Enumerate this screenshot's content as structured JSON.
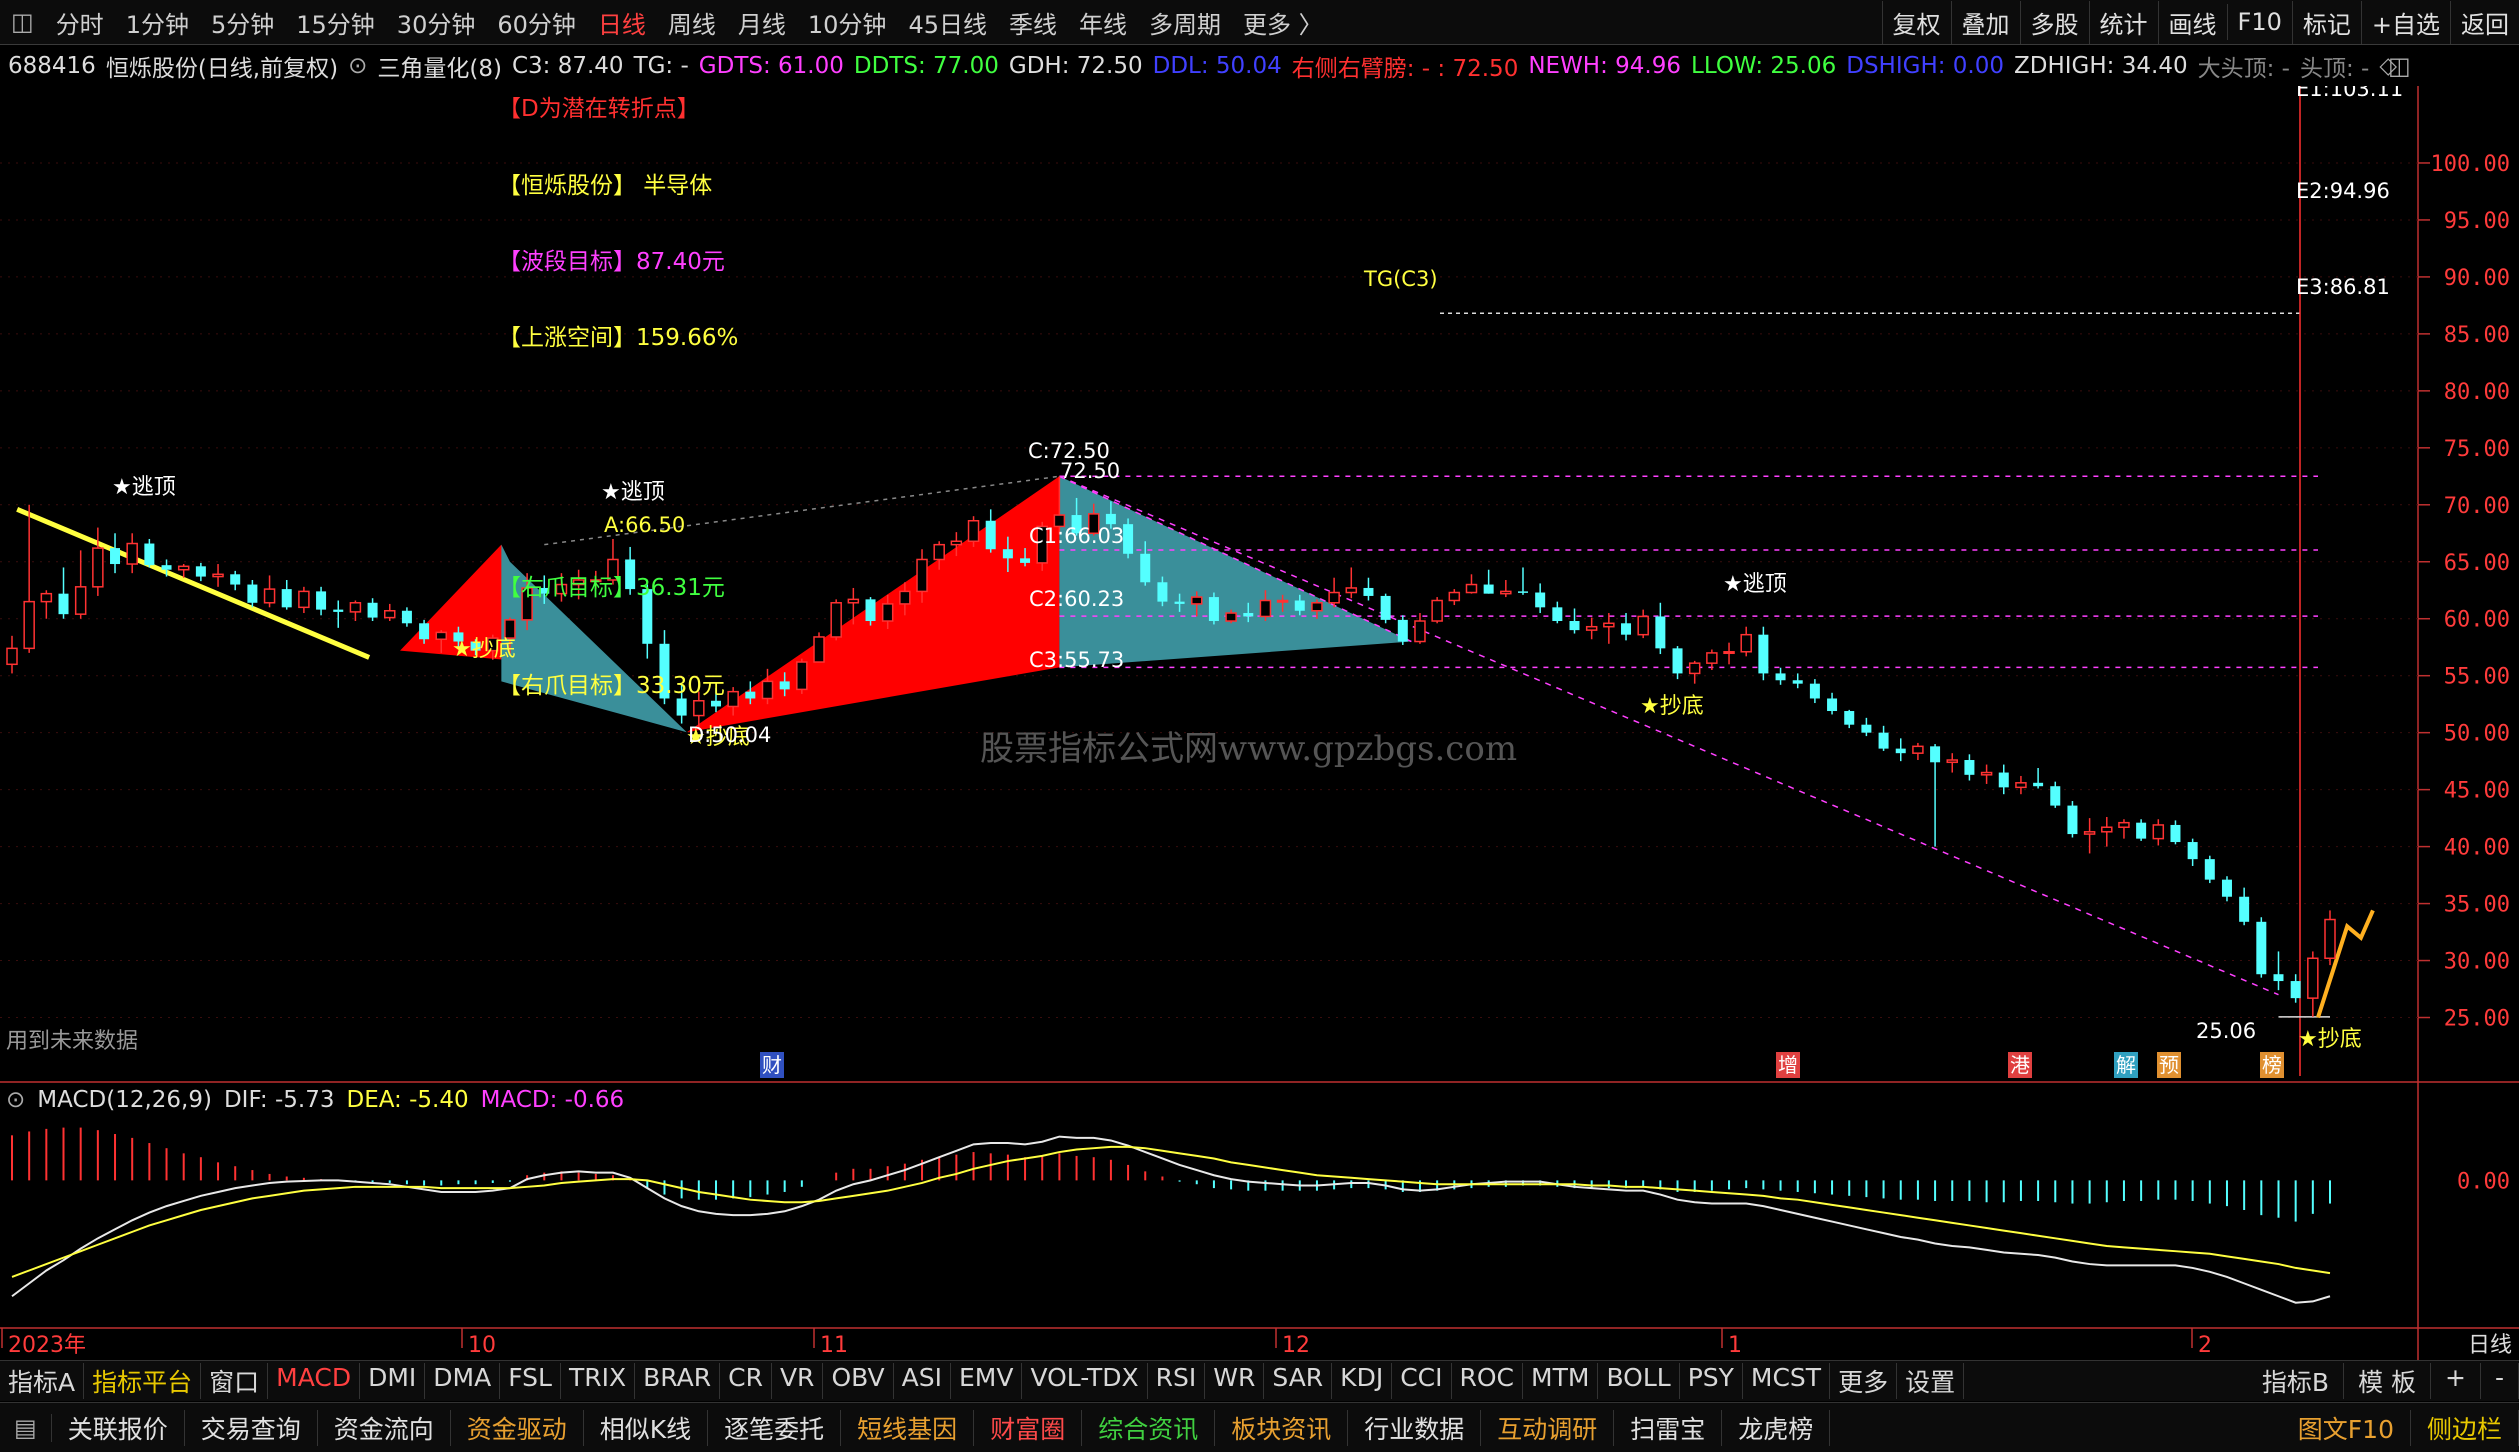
{
  "topbar": {
    "periods": [
      "分时",
      "1分钟",
      "5分钟",
      "15分钟",
      "30分钟",
      "60分钟",
      "日线",
      "周线",
      "月线",
      "10分钟",
      "45日线",
      "季线",
      "年线",
      "多周期",
      "更多 〉"
    ],
    "active_period": "日线",
    "right_buttons": [
      "复权",
      "叠加",
      "多股",
      "统计",
      "画线",
      "F10",
      "标记",
      "+自选",
      "返回"
    ]
  },
  "info": {
    "code": "688416",
    "name": "恒烁股份(日线,前复权)",
    "indicator": "三角量化(8)",
    "c3": "C3: 87.40",
    "tg": "TG: -",
    "gdts": "GDTS: 61.00",
    "ddts": "DDTS: 77.00",
    "gdh": "GDH: 72.50",
    "ddl": "DDL: 50.04",
    "right_arm": "右侧右臂膀: - : 72.50",
    "newh": "NEWH: 94.96",
    "llow": "LLOW: 25.06",
    "dshigh": "DSHIGH: 0.00",
    "zdhigh": "ZDHIGH: 34.40",
    "dtd": "大头顶: -",
    "td": "头顶: -"
  },
  "annotations": {
    "d_turn": "【D为潜在转折点】",
    "stock_label": "【恒烁股份】 半导体",
    "wave_target": "【波段目标】87.40元",
    "up_space": "【上涨空间】159.66%",
    "right_claw1": "【右爪目标】36.31元",
    "right_claw2": "【右爪目标】33.30元",
    "escape_top": "★逃顶",
    "buy_bottom": "★抄底",
    "a_label": "A:66.50",
    "c_label": "C:72.50",
    "c_val": "72.50",
    "c1": "C1:66.03",
    "c2": "C2:60.23",
    "c3": "C3:55.73",
    "d_label": "D:50.04",
    "tg_line": "TG(C3)",
    "e1": "E1:103.11",
    "e2": "E2:94.96",
    "e3": "E3:86.81",
    "low_value": "25.06",
    "future_data": "用到未来数据",
    "watermark": "股票指标公式网www.gpzbgs.com"
  },
  "event_marks": [
    {
      "text": "财",
      "color": "#3050c0"
    },
    {
      "text": "增",
      "color": "#e04040"
    },
    {
      "text": "港",
      "color": "#e04040"
    },
    {
      "text": "解",
      "color": "#30a0c0"
    },
    {
      "text": "预",
      "color": "#e09030"
    },
    {
      "text": "榜",
      "color": "#e09030"
    }
  ],
  "macd": {
    "title": "MACD(12,26,9)",
    "dif": "DIF: -5.73",
    "dea": "DEA: -5.40",
    "macd": "MACD: -0.66",
    "zero_label": "0.00"
  },
  "x_axis": {
    "labels": [
      "2023年",
      "10",
      "11",
      "12",
      "1",
      "2"
    ],
    "period_label": "日线"
  },
  "colors": {
    "up": "#ff3232",
    "down": "#54ffff",
    "red_triangle": "#ff0000",
    "teal_triangle": "#3a8f9a",
    "magenta": "#ff40ff",
    "yellow": "#ffff40",
    "axis": "#c03030"
  },
  "bottom1": {
    "items": [
      "指标A",
      "指标平台",
      "窗口",
      "MACD",
      "DMI",
      "DMA",
      "FSL",
      "TRIX",
      "BRAR",
      "CR",
      "VR",
      "OBV",
      "ASI",
      "EMV",
      "VOL-TDX",
      "RSI",
      "WR",
      "SAR",
      "KDJ",
      "CCI",
      "ROC",
      "MTM",
      "BOLL",
      "PSY",
      "MCST",
      "更多",
      "设置"
    ],
    "right": [
      "指标B",
      "模 板",
      "+",
      "-"
    ]
  },
  "bottom2": {
    "items": [
      "关联报价",
      "交易查询",
      "资金流向",
      "资金驱动",
      "相似K线",
      "逐笔委托",
      "短线基因",
      "财富圈",
      "综合资讯",
      "板块资讯",
      "行业数据",
      "互动调研",
      "扫雷宝",
      "龙虎榜"
    ],
    "right": [
      "图文F10",
      "侧边栏"
    ]
  },
  "chart_data": {
    "type": "candlestick",
    "y_ticks": [
      25,
      30,
      35,
      40,
      45,
      50,
      55,
      60,
      65,
      70,
      75,
      80,
      85,
      90,
      95,
      100
    ],
    "ylim": [
      22.5,
      105
    ],
    "macd_ylim": [
      -11,
      5
    ],
    "candles": [
      [
        56,
        58.5,
        55.2,
        57.4
      ],
      [
        57.4,
        70,
        57,
        61.5
      ],
      [
        61.5,
        62.5,
        60,
        62.2
      ],
      [
        62.2,
        64.5,
        60,
        60.4
      ],
      [
        60.4,
        66,
        60,
        62.8
      ],
      [
        62.8,
        68,
        62,
        66.2
      ],
      [
        66.2,
        67.5,
        64,
        64.8
      ],
      [
        64.8,
        67.5,
        64,
        66.6
      ],
      [
        66.6,
        67,
        64.5,
        64.7
      ],
      [
        64.7,
        65.2,
        63.7,
        64.3
      ],
      [
        64.3,
        64.8,
        63.6,
        64.6
      ],
      [
        64.6,
        64.9,
        63.3,
        63.7
      ],
      [
        63.7,
        64.8,
        62.8,
        63.9
      ],
      [
        63.9,
        64.2,
        62.5,
        63
      ],
      [
        63,
        63.4,
        61,
        61.4
      ],
      [
        61.4,
        63.8,
        61,
        62.6
      ],
      [
        62.6,
        63.4,
        60.8,
        61
      ],
      [
        61,
        62.8,
        60.5,
        62.4
      ],
      [
        62.4,
        62.8,
        60.3,
        60.8
      ],
      [
        60.8,
        61.6,
        59.2,
        60.6
      ],
      [
        60.6,
        61.6,
        59.8,
        61.4
      ],
      [
        61.4,
        61.8,
        59.8,
        60.1
      ],
      [
        60.1,
        61.3,
        59.8,
        60.7
      ],
      [
        60.7,
        61,
        59.3,
        59.6
      ],
      [
        59.6,
        59.9,
        57.8,
        58.2
      ],
      [
        58.2,
        59,
        57,
        58.8
      ],
      [
        58.8,
        59.3,
        57.4,
        58
      ],
      [
        58,
        58.2,
        56.8,
        57.2
      ],
      [
        57.2,
        58.6,
        56.4,
        58.3
      ],
      [
        58.3,
        60.1,
        56.8,
        59.9
      ],
      [
        59.9,
        64,
        59,
        62.7
      ],
      [
        62.7,
        63.8,
        61.3,
        62.2
      ],
      [
        62.2,
        64,
        61.5,
        63
      ],
      [
        63,
        64.3,
        61.7,
        63.4
      ],
      [
        63.4,
        64.2,
        62.6,
        63.4
      ],
      [
        63.4,
        67,
        63,
        65.2
      ],
      [
        65.2,
        66.3,
        62.1,
        62.6
      ],
      [
        62.6,
        63,
        56.5,
        57.8
      ],
      [
        57.8,
        59,
        52.5,
        53
      ],
      [
        53,
        54.2,
        50.8,
        51.5
      ],
      [
        51.5,
        53.6,
        50.3,
        52.8
      ],
      [
        52.8,
        53.9,
        51.8,
        52.3
      ],
      [
        52.3,
        54,
        51.5,
        53.6
      ],
      [
        53.6,
        54.5,
        52.5,
        53
      ],
      [
        53,
        55.6,
        52.5,
        54.5
      ],
      [
        54.5,
        55.3,
        53.2,
        53.8
      ],
      [
        53.8,
        56.5,
        53.4,
        56.2
      ],
      [
        56.2,
        58.8,
        56.2,
        58.4
      ],
      [
        58.4,
        61.7,
        58.1,
        61.4
      ],
      [
        61.4,
        62.7,
        59.5,
        61.7
      ],
      [
        61.7,
        61.9,
        59.4,
        59.8
      ],
      [
        59.8,
        62.1,
        59.1,
        61.3
      ],
      [
        61.3,
        63.2,
        60.3,
        62.4
      ],
      [
        62.4,
        66.1,
        61.4,
        65.2
      ],
      [
        65.2,
        66.8,
        64.3,
        66.5
      ],
      [
        66.5,
        67.6,
        65.5,
        66.8
      ],
      [
        66.8,
        69,
        66.3,
        68.6
      ],
      [
        68.6,
        69.6,
        65.8,
        66.1
      ],
      [
        66.1,
        67.2,
        64.1,
        65.3
      ],
      [
        65.3,
        66.2,
        64.6,
        64.9
      ],
      [
        64.9,
        68.5,
        64.2,
        68.1
      ],
      [
        68.1,
        72.5,
        67.4,
        69.1
      ],
      [
        69.1,
        70.6,
        67.3,
        67.5
      ],
      [
        67.5,
        70.1,
        67.3,
        69.2
      ],
      [
        69.2,
        70.3,
        67.9,
        68.3
      ],
      [
        68.3,
        68.8,
        65.3,
        65.7
      ],
      [
        65.7,
        66.8,
        62.9,
        63.2
      ],
      [
        63.2,
        63.7,
        61.1,
        61.5
      ],
      [
        61.5,
        62.2,
        60.6,
        61.3
      ],
      [
        61.3,
        62.4,
        60.2,
        61.9
      ],
      [
        61.9,
        62.3,
        59.5,
        59.8
      ],
      [
        59.8,
        60.8,
        59.6,
        60.5
      ],
      [
        60.5,
        61.4,
        59.7,
        60.2
      ],
      [
        60.2,
        62.5,
        59.8,
        61.6
      ],
      [
        61.6,
        62.1,
        60.6,
        61.6
      ],
      [
        61.6,
        62.1,
        60.3,
        60.7
      ],
      [
        60.7,
        61.7,
        60,
        61.4
      ],
      [
        61.4,
        63.6,
        61,
        62.3
      ],
      [
        62.3,
        64.5,
        61.8,
        62.7
      ],
      [
        62.7,
        63.6,
        61.6,
        62
      ],
      [
        62,
        62.2,
        59.6,
        59.9
      ],
      [
        59.9,
        60.3,
        57.7,
        58
      ],
      [
        58,
        60.5,
        57.8,
        59.8
      ],
      [
        59.8,
        61.9,
        59.6,
        61.6
      ],
      [
        61.6,
        62.6,
        61.2,
        62.3
      ],
      [
        62.3,
        63.9,
        62.2,
        63
      ],
      [
        63,
        64.3,
        62.2,
        62.2
      ],
      [
        62.2,
        63.4,
        61.9,
        62.4
      ],
      [
        62.4,
        64.5,
        62.1,
        62.3
      ],
      [
        62.3,
        63.1,
        60.5,
        61
      ],
      [
        61,
        61.5,
        59.6,
        59.8
      ],
      [
        59.8,
        60.9,
        58.7,
        59
      ],
      [
        59,
        60.1,
        58.2,
        59.3
      ],
      [
        59.3,
        60.5,
        57.8,
        59.6
      ],
      [
        59.6,
        60.5,
        58.1,
        58.6
      ],
      [
        58.6,
        60.8,
        58.3,
        60.2
      ],
      [
        60.2,
        61.4,
        56.9,
        57.4
      ],
      [
        57.4,
        57.6,
        54.7,
        55.2
      ],
      [
        55.2,
        56.3,
        54.3,
        56.1
      ],
      [
        56.1,
        57.3,
        55.5,
        57
      ],
      [
        57,
        57.9,
        56,
        57.1
      ],
      [
        57.1,
        59.3,
        56.7,
        58.6
      ],
      [
        58.6,
        59.3,
        54.6,
        55.2
      ],
      [
        55.2,
        55.7,
        54.2,
        54.6
      ],
      [
        54.6,
        55.2,
        53.9,
        54.3
      ],
      [
        54.3,
        54.7,
        52.6,
        53
      ],
      [
        53,
        53.5,
        51.6,
        51.9
      ],
      [
        51.9,
        52,
        50.4,
        50.7
      ],
      [
        50.7,
        51.3,
        49.7,
        50
      ],
      [
        50,
        50.6,
        48.4,
        48.6
      ],
      [
        48.6,
        49.5,
        47.5,
        48.2
      ],
      [
        48.2,
        49.1,
        47.6,
        48.8
      ],
      [
        48.8,
        49,
        40,
        47.4
      ],
      [
        47.4,
        48.2,
        46.5,
        47.6
      ],
      [
        47.6,
        48.1,
        45.8,
        46.3
      ],
      [
        46.3,
        47.2,
        45.5,
        46.5
      ],
      [
        46.5,
        47.2,
        44.6,
        45.2
      ],
      [
        45.2,
        46.2,
        44.6,
        45.6
      ],
      [
        45.6,
        46.9,
        45.1,
        45.3
      ],
      [
        45.3,
        45.7,
        43.4,
        43.6
      ],
      [
        43.6,
        44,
        40.8,
        41.1
      ],
      [
        41.1,
        42.5,
        39.4,
        41.3
      ],
      [
        41.3,
        42.6,
        40,
        41.7
      ],
      [
        41.7,
        42.4,
        40.7,
        42.1
      ],
      [
        42.1,
        42.4,
        40.5,
        40.7
      ],
      [
        40.7,
        42.4,
        40.1,
        41.9
      ],
      [
        41.9,
        42.3,
        40.2,
        40.4
      ],
      [
        40.4,
        40.7,
        38.3,
        38.9
      ],
      [
        38.9,
        39.2,
        36.8,
        37.1
      ],
      [
        37.1,
        37.4,
        35.2,
        35.6
      ],
      [
        35.6,
        36.4,
        33.1,
        33.4
      ],
      [
        33.4,
        33.8,
        28.5,
        28.8
      ],
      [
        28.8,
        30.8,
        27.4,
        28.2
      ],
      [
        28.2,
        28.8,
        26.3,
        26.7
      ],
      [
        26.7,
        30.8,
        25.06,
        30.2
      ],
      [
        30.2,
        34.4,
        29.6,
        33.6
      ]
    ],
    "macd_bars": [
      3.5,
      3.8,
      4,
      4.1,
      4.1,
      3.9,
      3.6,
      3.3,
      2.9,
      2.5,
      2.1,
      1.8,
      1.4,
      1.1,
      0.8,
      0.5,
      0.3,
      0.2,
      0.1,
      0,
      -0.1,
      -0.2,
      -0.2,
      -0.3,
      -0.4,
      -0.4,
      -0.3,
      -0.3,
      -0.2,
      -0.1,
      0.4,
      0.6,
      0.7,
      0.6,
      0.5,
      0.4,
      0.1,
      -0.6,
      -1.1,
      -1.4,
      -1.5,
      -1.5,
      -1.4,
      -1.3,
      -1.1,
      -0.9,
      -0.5,
      0,
      0.6,
      0.9,
      0.9,
      1.1,
      1.3,
      1.6,
      1.8,
      2,
      2.2,
      2.1,
      2,
      1.8,
      1.9,
      2.1,
      1.9,
      1.8,
      1.6,
      1.2,
      0.7,
      0.3,
      -0.1,
      -0.3,
      -0.6,
      -0.7,
      -0.8,
      -0.8,
      -0.8,
      -0.8,
      -0.8,
      -0.7,
      -0.6,
      -0.6,
      -0.7,
      -0.9,
      -0.9,
      -0.8,
      -0.7,
      -0.6,
      -0.5,
      -0.5,
      -0.4,
      -0.4,
      -0.5,
      -0.6,
      -0.6,
      -0.6,
      -0.6,
      -0.5,
      -0.7,
      -0.9,
      -0.9,
      -0.8,
      -0.7,
      -0.6,
      -0.7,
      -0.8,
      -0.9,
      -1,
      -1.1,
      -1.2,
      -1.3,
      -1.4,
      -1.5,
      -1.5,
      -1.6,
      -1.6,
      -1.6,
      -1.7,
      -1.7,
      -1.6,
      -1.6,
      -1.7,
      -1.8,
      -1.8,
      -1.7,
      -1.6,
      -1.6,
      -1.5,
      -1.5,
      -1.6,
      -1.8,
      -2,
      -2.3,
      -2.7,
      -2.9,
      -3.2,
      -2.6,
      -1.8
    ],
    "dif": [
      -9,
      -8,
      -7,
      -6.2,
      -5.3,
      -4.5,
      -3.8,
      -3.1,
      -2.5,
      -2,
      -1.6,
      -1.2,
      -0.9,
      -0.6,
      -0.4,
      -0.2,
      -0.1,
      -0.05,
      0,
      0,
      -0.1,
      -0.2,
      -0.3,
      -0.5,
      -0.7,
      -0.9,
      -0.9,
      -0.9,
      -0.8,
      -0.6,
      0.1,
      0.4,
      0.6,
      0.7,
      0.6,
      0.6,
      0.2,
      -0.6,
      -1.4,
      -2,
      -2.4,
      -2.6,
      -2.7,
      -2.7,
      -2.6,
      -2.4,
      -2,
      -1.5,
      -0.8,
      -0.3,
      0,
      0.4,
      0.8,
      1.3,
      1.8,
      2.3,
      2.8,
      2.9,
      2.9,
      2.8,
      3,
      3.4,
      3.3,
      3.3,
      3.1,
      2.7,
      2.2,
      1.7,
      1.2,
      0.8,
      0.4,
      0.1,
      -0.1,
      -0.2,
      -0.3,
      -0.4,
      -0.4,
      -0.3,
      -0.2,
      -0.2,
      -0.4,
      -0.7,
      -0.8,
      -0.7,
      -0.5,
      -0.3,
      -0.2,
      -0.1,
      -0.1,
      -0.1,
      -0.3,
      -0.5,
      -0.6,
      -0.7,
      -0.8,
      -0.8,
      -1.1,
      -1.5,
      -1.7,
      -1.8,
      -1.8,
      -1.8,
      -2,
      -2.3,
      -2.6,
      -2.9,
      -3.2,
      -3.5,
      -3.8,
      -4.1,
      -4.4,
      -4.6,
      -4.9,
      -5.1,
      -5.2,
      -5.4,
      -5.6,
      -5.7,
      -5.8,
      -6,
      -6.3,
      -6.5,
      -6.6,
      -6.6,
      -6.6,
      -6.6,
      -6.6,
      -6.8,
      -7.1,
      -7.5,
      -8,
      -8.5,
      -9,
      -9.5,
      -9.4,
      -9
    ],
    "dea": [
      -7.5,
      -7,
      -6.5,
      -6,
      -5.5,
      -5,
      -4.5,
      -4,
      -3.5,
      -3.1,
      -2.7,
      -2.3,
      -2,
      -1.7,
      -1.4,
      -1.2,
      -1,
      -0.8,
      -0.7,
      -0.6,
      -0.5,
      -0.5,
      -0.5,
      -0.5,
      -0.5,
      -0.6,
      -0.6,
      -0.6,
      -0.6,
      -0.6,
      -0.5,
      -0.4,
      -0.2,
      -0.1,
      0,
      0.1,
      0.1,
      0,
      -0.3,
      -0.6,
      -0.9,
      -1.1,
      -1.3,
      -1.5,
      -1.6,
      -1.7,
      -1.7,
      -1.6,
      -1.4,
      -1.2,
      -1,
      -0.8,
      -0.5,
      -0.2,
      0.2,
      0.5,
      0.9,
      1.2,
      1.5,
      1.7,
      1.9,
      2.2,
      2.4,
      2.5,
      2.6,
      2.6,
      2.5,
      2.3,
      2.1,
      1.9,
      1.7,
      1.4,
      1.2,
      1,
      0.8,
      0.6,
      0.4,
      0.3,
      0.2,
      0.1,
      0,
      -0.1,
      -0.2,
      -0.3,
      -0.3,
      -0.3,
      -0.3,
      -0.3,
      -0.3,
      -0.3,
      -0.3,
      -0.3,
      -0.4,
      -0.4,
      -0.5,
      -0.5,
      -0.6,
      -0.7,
      -0.8,
      -0.9,
      -1,
      -1.1,
      -1.2,
      -1.4,
      -1.5,
      -1.7,
      -1.9,
      -2.1,
      -2.3,
      -2.5,
      -2.7,
      -2.9,
      -3.1,
      -3.3,
      -3.5,
      -3.7,
      -3.9,
      -4.1,
      -4.3,
      -4.5,
      -4.7,
      -4.9,
      -5.1,
      -5.2,
      -5.3,
      -5.4,
      -5.5,
      -5.6,
      -5.7,
      -5.9,
      -6.1,
      -6.3,
      -6.5,
      -6.8,
      -7,
      -7.2
    ]
  }
}
